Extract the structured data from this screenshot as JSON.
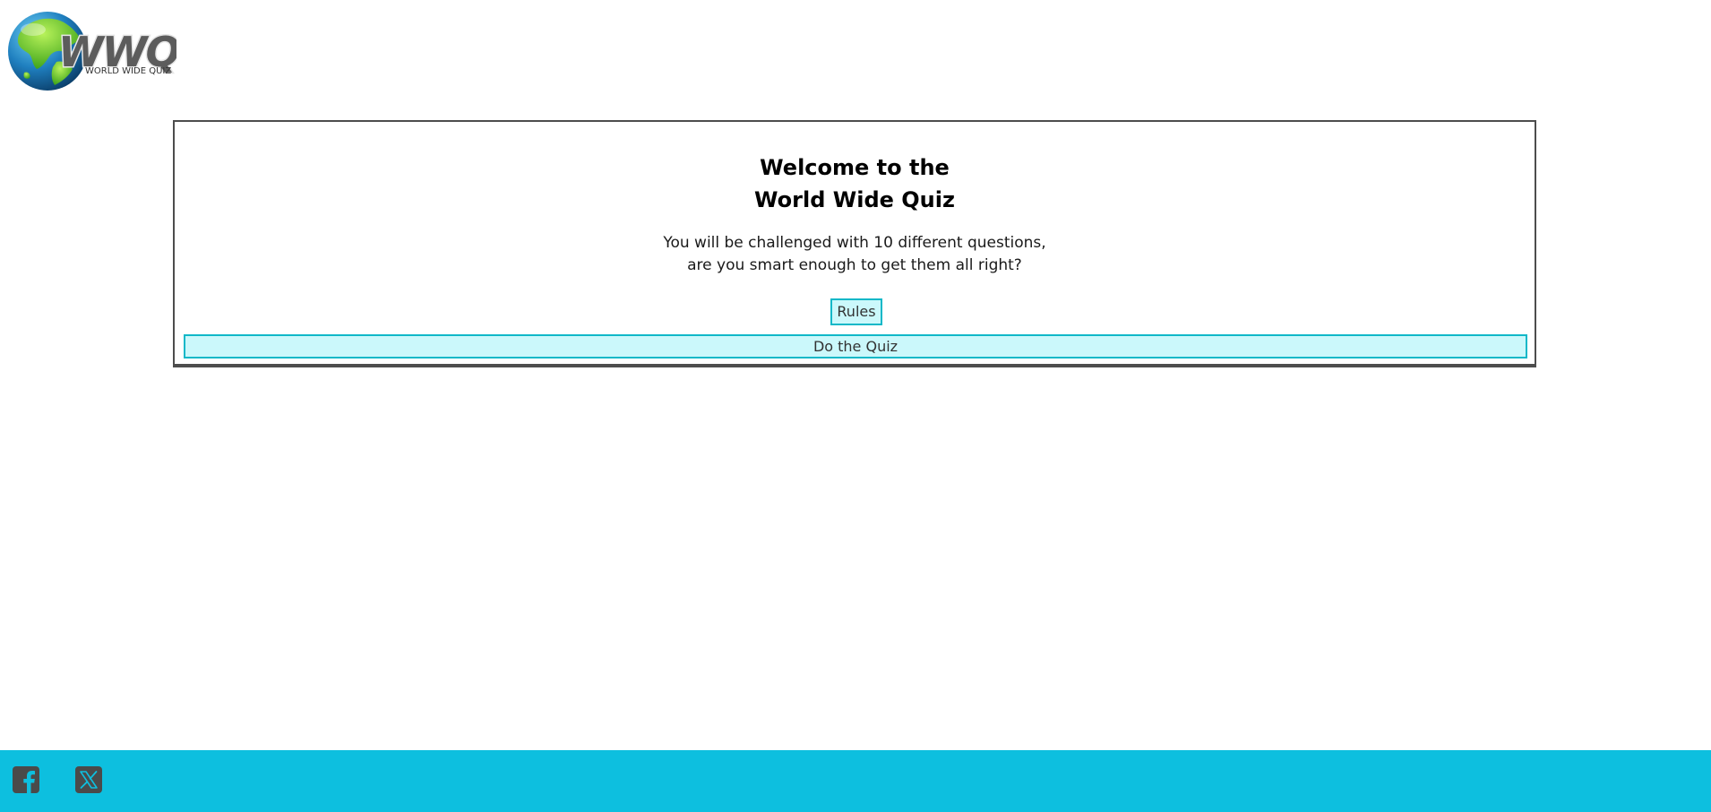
{
  "logo": {
    "letters": "WWQ",
    "tagline": "WORLD WIDE QUIZ"
  },
  "welcome": {
    "title_line1": "Welcome to the",
    "title_line2": "World Wide Quiz",
    "text_line1": "You will be challenged with 10 different questions,",
    "text_line2": "are you smart enough to get them all right?"
  },
  "buttons": {
    "rules_label": "Rules",
    "quiz_label": "Do the Quiz"
  },
  "footer": {
    "social": [
      {
        "icon": "facebook-icon"
      },
      {
        "icon": "x-icon"
      }
    ]
  },
  "colors": {
    "accent": "#0dbfdf",
    "button_border": "#10b8c8",
    "button_fill": "#cbf8fb",
    "card_border": "#4d4d4d",
    "globe_ocean": "#1f7fbf",
    "globe_land": "#5fcf1f"
  }
}
